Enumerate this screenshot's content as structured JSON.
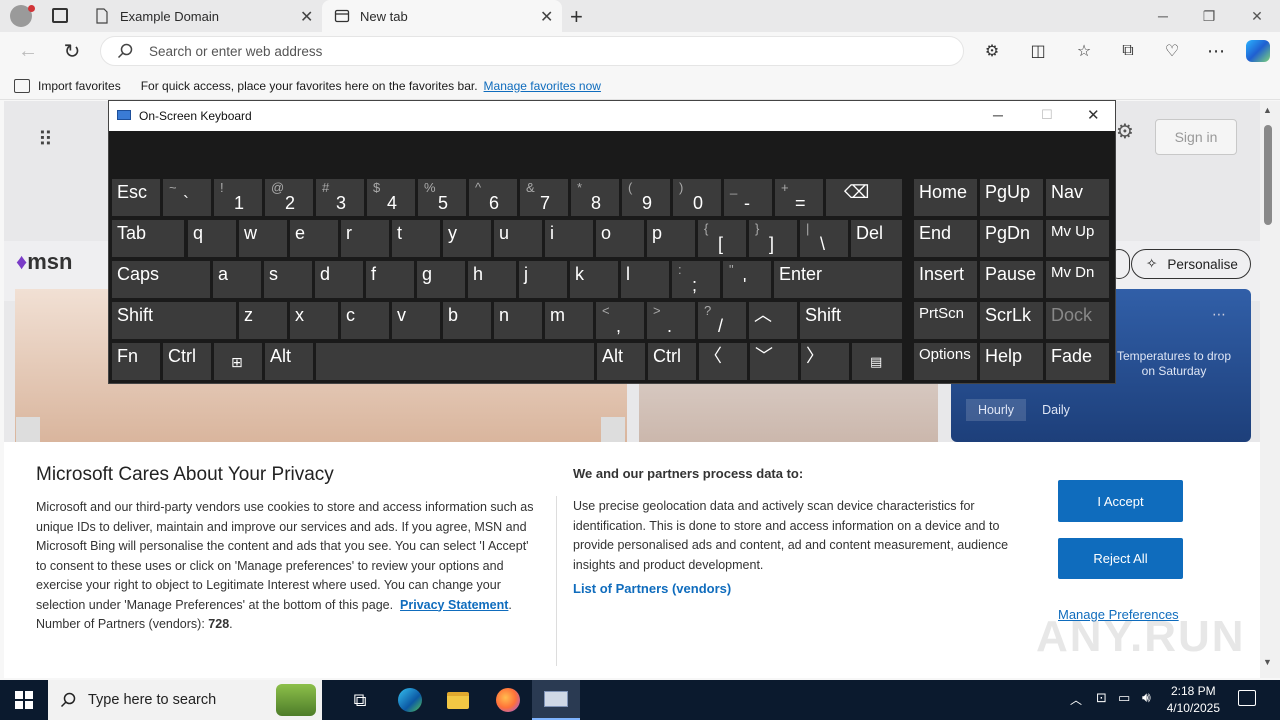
{
  "browser": {
    "tabs": [
      {
        "title": "Example Domain"
      },
      {
        "title": "New tab"
      }
    ],
    "address_placeholder": "Search or enter web address",
    "favorites_bar": {
      "import_label": "Import favorites",
      "message": "For quick access, place your favorites here on the favorites bar.",
      "manage_link": "Manage favorites now"
    }
  },
  "msn": {
    "logo": "msn",
    "sign_in": "Sign in",
    "personalise": "Personalise",
    "weather_note": "Temperatures to drop on Saturday",
    "weather_tabs": [
      "Hourly",
      "Daily"
    ]
  },
  "osk": {
    "title": "On-Screen Keyboard",
    "keys": {
      "esc": "Esc",
      "tab": "Tab",
      "caps": "Caps",
      "shift": "Shift",
      "fn": "Fn",
      "ctrl": "Ctrl",
      "alt": "Alt",
      "del": "Del",
      "enter": "Enter",
      "home": "Home",
      "pgup": "PgUp",
      "nav": "Nav",
      "end": "End",
      "pgdn": "PgDn",
      "mvup": "Mv Up",
      "insert": "Insert",
      "pause": "Pause",
      "mvdn": "Mv Dn",
      "prtscn": "PrtScn",
      "scrlk": "ScrLk",
      "dock": "Dock",
      "options": "Options",
      "help": "Help",
      "fade": "Fade"
    },
    "row1": [
      [
        "~",
        "`"
      ],
      [
        "!",
        "1"
      ],
      [
        "@",
        "2"
      ],
      [
        "#",
        "3"
      ],
      [
        "$",
        "4"
      ],
      [
        "%",
        "5"
      ],
      [
        "^",
        "6"
      ],
      [
        "&",
        "7"
      ],
      [
        "*",
        "8"
      ],
      [
        "(",
        "9"
      ],
      [
        ")",
        "0"
      ],
      [
        "_",
        "-"
      ],
      [
        "+",
        "="
      ]
    ],
    "row2": [
      "q",
      "w",
      "e",
      "r",
      "t",
      "y",
      "u",
      "i",
      "o",
      "p"
    ],
    "row2b": [
      [
        "{",
        "["
      ],
      [
        "}",
        "]"
      ],
      [
        "|",
        "\\"
      ]
    ],
    "row3": [
      "a",
      "s",
      "d",
      "f",
      "g",
      "h",
      "j",
      "k",
      "l"
    ],
    "row3b": [
      [
        ":",
        ";"
      ],
      [
        "\"",
        "'"
      ]
    ],
    "row4": [
      "z",
      "x",
      "c",
      "v",
      "b",
      "n",
      "m"
    ],
    "row4b": [
      [
        "<",
        ","
      ],
      [
        ">",
        "."
      ],
      [
        "?",
        "/"
      ]
    ]
  },
  "cookie": {
    "title": "Microsoft Cares About Your Privacy",
    "body": "Microsoft and our third-party vendors use cookies to store and access information such as unique IDs to deliver, maintain and improve our services and ads. If you agree, MSN and Microsoft Bing will personalise the content and ads that you see. You can select 'I Accept' to consent to these uses or click on 'Manage preferences' to review your options and exercise your right to object to Legitimate Interest where used.  You can change your selection under 'Manage Preferences' at the bottom of this page.",
    "privacy_link": "Privacy Statement",
    "partners_label": "Number of Partners (vendors):",
    "partners_count": "728",
    "right_title": "We and our partners process data to:",
    "right_body": "Use precise geolocation data and actively scan device characteristics for identification. This is done to store and access information on a device and to provide personalised ads and content, ad and content measurement, audience insights and product development.",
    "partners_link": "List of Partners (vendors)",
    "accept": "I Accept",
    "reject": "Reject All",
    "manage": "Manage Preferences"
  },
  "taskbar": {
    "search_placeholder": "Type here to search",
    "time": "2:18 PM",
    "date": "4/10/2025"
  },
  "watermark": "ANY.RUN"
}
